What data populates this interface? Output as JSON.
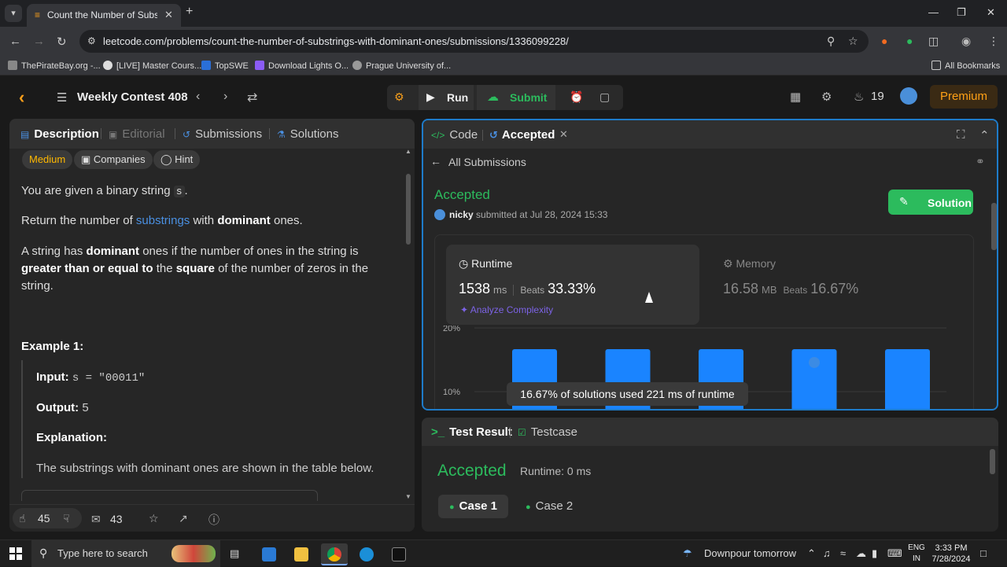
{
  "browser": {
    "tab_title": "Count the Number of Substring",
    "url": "leetcode.com/problems/count-the-number-of-substrings-with-dominant-ones/submissions/1336099228/",
    "bookmarks": [
      "ThePirateBay.org -...",
      "[LIVE] Master Cours...",
      "TopSWE",
      "Download Lights O...",
      "Prague University of..."
    ],
    "all_bookmarks": "All Bookmarks"
  },
  "header": {
    "contest": "Weekly Contest 408",
    "run": "Run",
    "submit": "Submit",
    "streak": "19",
    "premium": "Premium"
  },
  "left": {
    "tabs": [
      "Description",
      "Editorial",
      "Submissions",
      "Solutions"
    ],
    "difficulty": "Medium",
    "chips": [
      "Companies",
      "Hint"
    ],
    "p1_a": "You are given a binary string ",
    "p1_code": "s",
    "p1_b": ".",
    "p2_a": "Return the number of ",
    "p2_link": "substrings",
    "p2_b": " with ",
    "p2_bold": "dominant",
    "p2_c": " ones.",
    "p3_a": "A string has ",
    "p3_bold1": "dominant",
    "p3_b": " ones if the number of ones in the string is ",
    "p3_bold2": "greater than or equal to",
    "p3_c": " the ",
    "p3_bold3": "square",
    "p3_d": " of the number of zeros in the string.",
    "example_title": "Example 1:",
    "input_label": "Input:",
    "input_value": "s = \"00011\"",
    "output_label": "Output:",
    "output_value": "5",
    "explanation_label": "Explanation:",
    "explanation_text": "The substrings with dominant ones are shown in the table below.",
    "likes": "45",
    "comments": "43"
  },
  "right": {
    "tabs": [
      "Code",
      "Accepted"
    ],
    "all_submissions": "All Submissions",
    "status": "Accepted",
    "user": "nicky",
    "submitted_at": "submitted at Jul 28, 2024 15:33",
    "solution_btn": "Solution",
    "runtime_label": "Runtime",
    "runtime_value": "1538",
    "runtime_unit": "ms",
    "beats_label": "Beats",
    "runtime_beats": "33.33%",
    "analyze": "Analyze Complexity",
    "memory_label": "Memory",
    "memory_value": "16.58",
    "memory_unit": "MB",
    "memory_beats": "16.67%",
    "tooltip": "16.67% of solutions used 221 ms of runtime"
  },
  "chart_data": {
    "type": "bar",
    "yticks": [
      "20%",
      "10%"
    ],
    "values": [
      16.67,
      16.67,
      16.67,
      16.67,
      16.67
    ],
    "highlight_index": 3,
    "bar_color": "#1a84ff"
  },
  "test": {
    "tabs": [
      "Test Result",
      "Testcase"
    ],
    "status": "Accepted",
    "runtime": "Runtime: 0 ms",
    "cases": [
      "Case 1",
      "Case 2"
    ]
  },
  "taskbar": {
    "search_placeholder": "Type here to search",
    "weather": "Downpour tomorrow",
    "lang1": "ENG",
    "lang2": "IN",
    "time": "3:33 PM",
    "date": "7/28/2024"
  }
}
